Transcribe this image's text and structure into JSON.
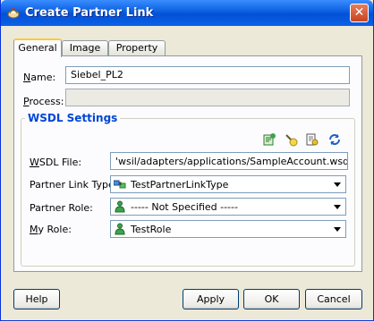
{
  "window": {
    "title": "Create Partner Link"
  },
  "tabs": [
    {
      "label": "General",
      "active": true
    },
    {
      "label": "Image",
      "active": false
    },
    {
      "label": "Property",
      "active": false
    }
  ],
  "general": {
    "name_label": "Name:",
    "name_value": "Siebel_PL2",
    "process_label": "Process:",
    "process_value": ""
  },
  "wsdl": {
    "group_title": "WSDL Settings",
    "toolbar_icons": [
      "service-explorer-icon",
      "define-adapter-icon",
      "browse-wsdl-icon",
      "refresh-icon"
    ],
    "file_label": "WSDL File:",
    "file_value": "'wsil/adapters/applications/SampleAccount.wsdl?wsdl",
    "plt_label": "Partner Link Type:",
    "plt_value": "TestPartnerLinkType",
    "partner_role_label": "Partner Role:",
    "partner_role_value": "----- Not Specified -----",
    "my_role_label": "My Role:",
    "my_role_value": "TestRole"
  },
  "buttons": {
    "help": "Help",
    "apply": "Apply",
    "ok": "OK",
    "cancel": "Cancel"
  },
  "colors": {
    "titlebar": "#0a5fe0",
    "group_title": "#0046d5",
    "dialog_bg": "#ece9d8"
  }
}
